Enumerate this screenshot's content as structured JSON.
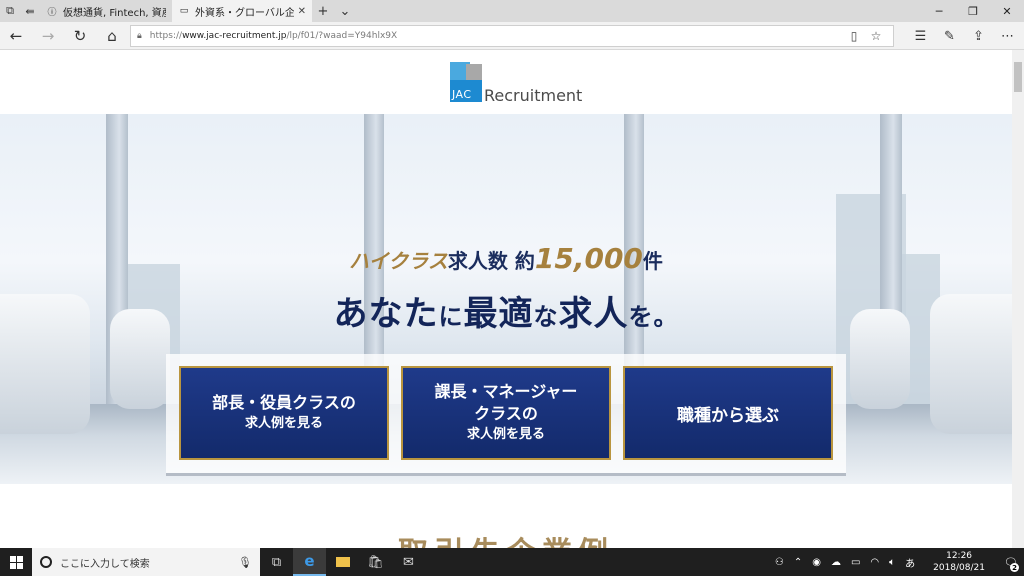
{
  "browser": {
    "tabs": [
      {
        "title": "仮想通貨, Fintech, 資産運用",
        "active": false
      },
      {
        "title": "外資系・グローバル企業・ハ",
        "active": true
      }
    ],
    "address": {
      "https": "https://",
      "host": "www.jac-recruitment.jp",
      "path": "/lp/f01/?waad=Y94hlx9X"
    }
  },
  "page": {
    "logo": {
      "mark": "JAC",
      "text": "Recruitment"
    },
    "catch": {
      "line1_prefix": "ハイクラス",
      "line1_mid": "求人数 約",
      "line1_number": "15,000",
      "line1_suffix": "件",
      "line2_a": "あなた",
      "line2_b": "に",
      "line2_c": "最適",
      "line2_d": "な",
      "line2_e": "求人",
      "line2_f": "を。"
    },
    "buttons": [
      {
        "line1": "部長・役員クラスの",
        "line2": "求人例を見る"
      },
      {
        "line1": "課長・マネージャー",
        "line1b": "クラスの",
        "line2": "求人例を見る"
      },
      {
        "line1": "職種から選ぶ"
      }
    ],
    "section_heading": "取引先企業例"
  },
  "taskbar": {
    "search_placeholder": "ここに入力して検索",
    "ime": "あ",
    "time": "12:26",
    "date": "2018/08/21",
    "notifications": "2"
  },
  "colors": {
    "navy": "#132559",
    "gold": "#a6813e",
    "button_bg": "#1f3a8a",
    "logo_blue": "#1d8ad1"
  }
}
